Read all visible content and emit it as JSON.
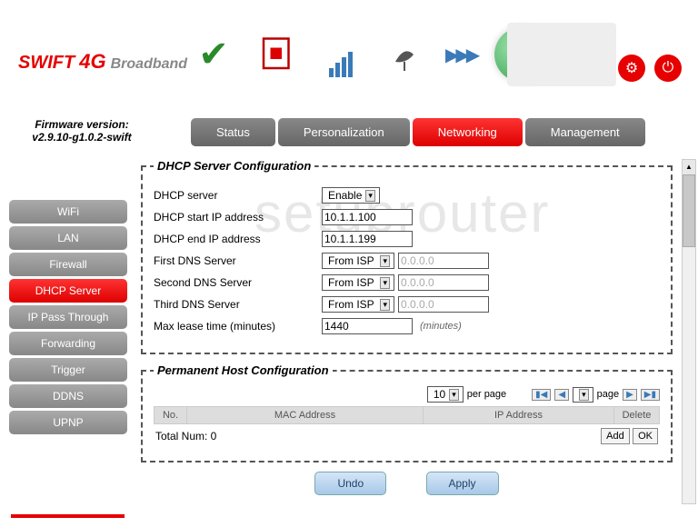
{
  "logo": {
    "swift": "SWIFT",
    "fourg": "4G",
    "bb": "Broadband"
  },
  "firmware": {
    "label": "Firmware version:",
    "version": "v2.9.10-g1.0.2-swift"
  },
  "topnav": {
    "status": "Status",
    "personalization": "Personalization",
    "networking": "Networking",
    "management": "Management"
  },
  "sidebar": {
    "wifi": "WiFi",
    "lan": "LAN",
    "firewall": "Firewall",
    "dhcp": "DHCP Server",
    "ippass": "IP Pass Through",
    "forwarding": "Forwarding",
    "trigger": "Trigger",
    "ddns": "DDNS",
    "upnp": "UPNP"
  },
  "dhcp": {
    "legend": "DHCP Server Configuration",
    "server_label": "DHCP server",
    "server_value": "Enable",
    "start_label": "DHCP start IP address",
    "start_value": "10.1.1.100",
    "end_label": "DHCP end IP address",
    "end_value": "10.1.1.199",
    "dns1_label": "First DNS Server",
    "dns1_mode": "From ISP",
    "dns1_ip": "0.0.0.0",
    "dns2_label": "Second DNS Server",
    "dns2_mode": "From ISP",
    "dns2_ip": "0.0.0.0",
    "dns3_label": "Third DNS Server",
    "dns3_mode": "From ISP",
    "dns3_ip": "0.0.0.0",
    "lease_label": "Max lease time (minutes)",
    "lease_value": "1440",
    "lease_hint": "(minutes)"
  },
  "perm": {
    "legend": "Permanent Host Configuration",
    "perpage_value": "10",
    "perpage_label": "per page",
    "page_label": "page",
    "col_no": "No.",
    "col_mac": "MAC Address",
    "col_ip": "IP Address",
    "col_del": "Delete",
    "total": "Total Num: 0",
    "add": "Add",
    "ok": "OK"
  },
  "actions": {
    "undo": "Undo",
    "apply": "Apply"
  },
  "watermark": "setuprouter"
}
